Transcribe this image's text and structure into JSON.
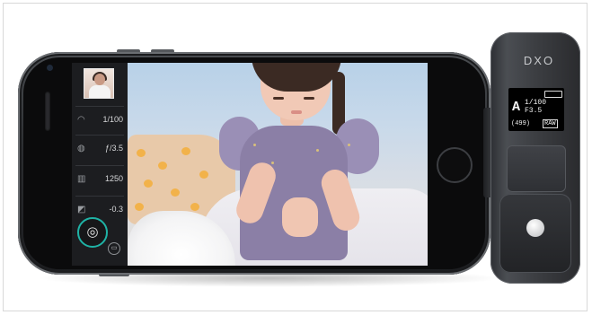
{
  "camera_app": {
    "settings": [
      {
        "icon": "shutter-speed-icon",
        "glyph": "◠",
        "value": "1/100"
      },
      {
        "icon": "aperture-icon",
        "glyph": "◍",
        "value": "ƒ/3.5"
      },
      {
        "icon": "iso-icon",
        "glyph": "▥",
        "value": "1250"
      },
      {
        "icon": "exposure-compensation-icon",
        "glyph": "◩",
        "value": "-0.3"
      }
    ],
    "shutter_glyph": "◎",
    "video_glyph": "▭",
    "sliders_glyph": "≡",
    "auto_label": "A",
    "accent_color": "#1fb3a6"
  },
  "dxo_module": {
    "brand": "DXO",
    "screen": {
      "mode": "A",
      "shutter": "1/100",
      "aperture": "F3.5",
      "shots_left": "(499)",
      "format": "RAW"
    }
  }
}
